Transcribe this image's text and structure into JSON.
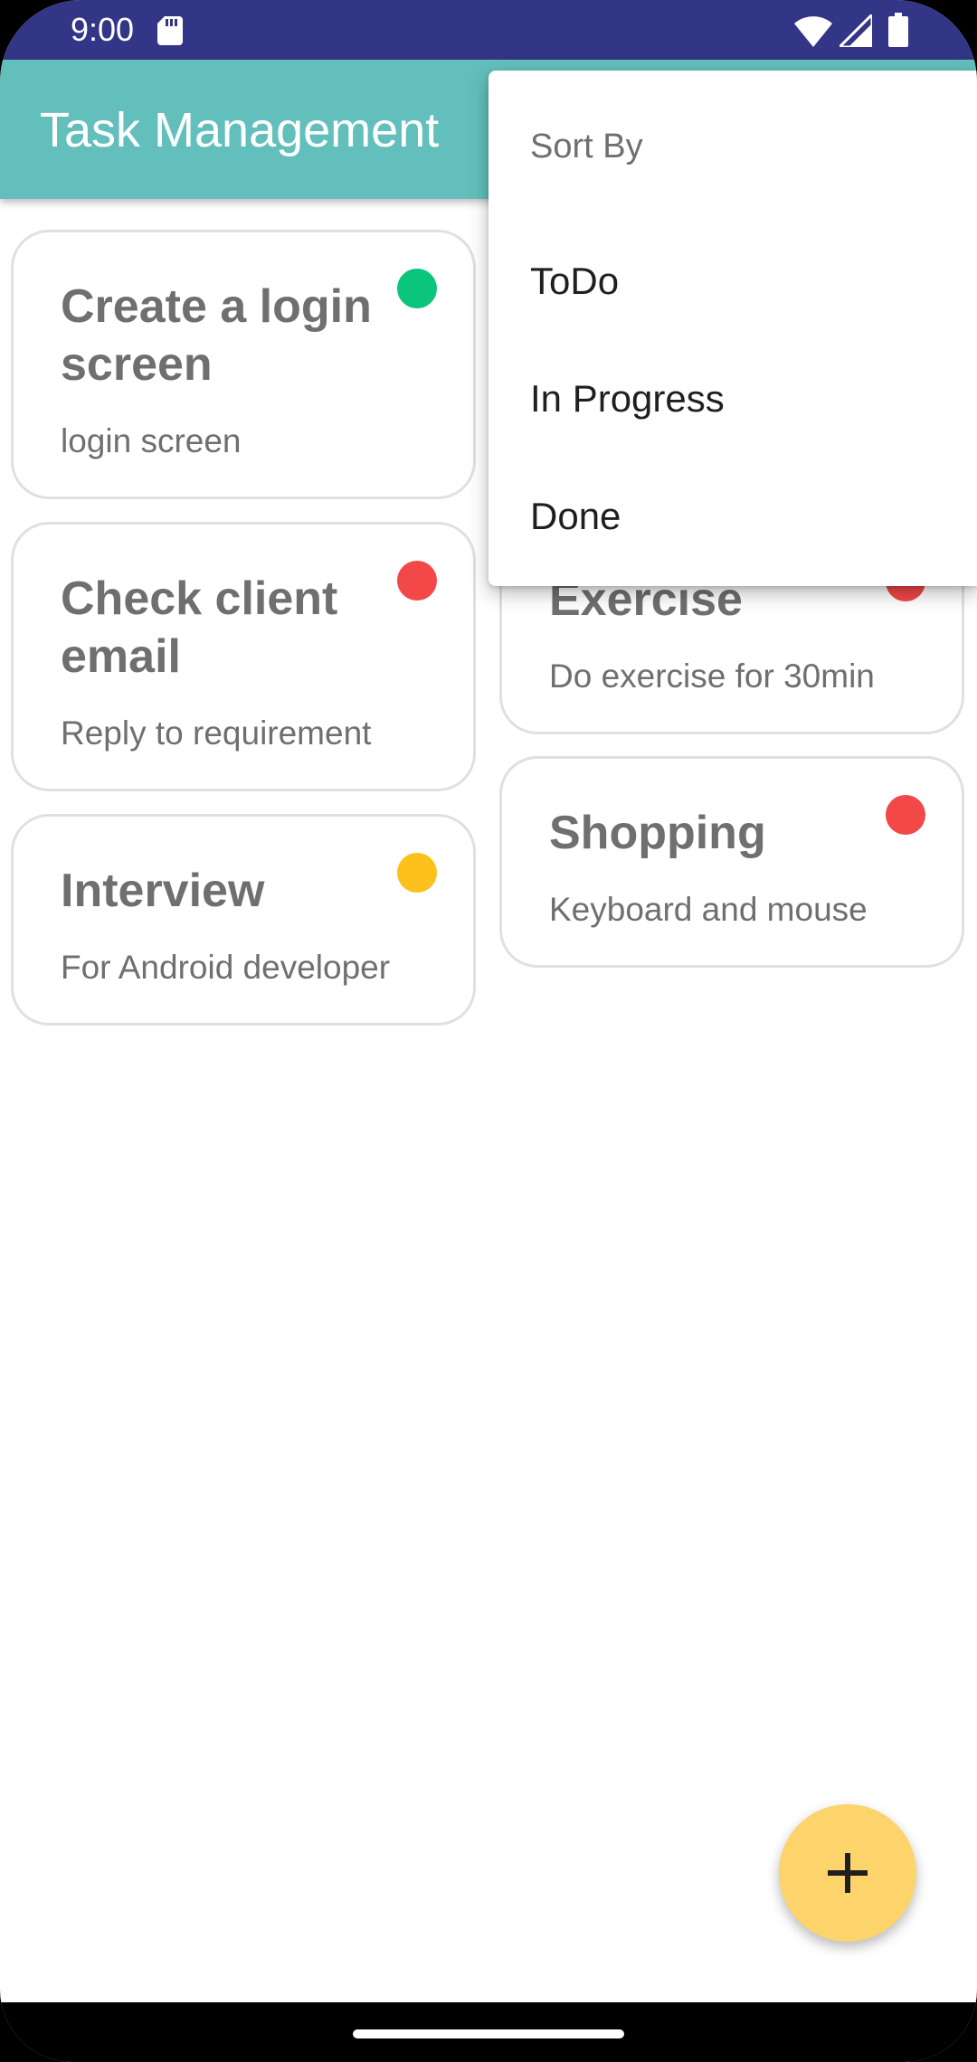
{
  "status_bar": {
    "time": "9:00",
    "icons": [
      "sd-card-icon",
      "wifi-icon",
      "signal-icon",
      "battery-icon"
    ]
  },
  "app_bar": {
    "title": "Task Management"
  },
  "tasks_left": [
    {
      "title": "Create a login screen",
      "description": "login screen",
      "status_color": "#0bc57b"
    },
    {
      "title": "Check client email",
      "description": "Reply to requirement",
      "status_color": "#f34848"
    },
    {
      "title": "Interview",
      "description": "For Android developer",
      "status_color": "#fdc11d"
    }
  ],
  "tasks_right": [
    {
      "title": "Exercise",
      "description": "Do exercise for 30min",
      "status_color": "#f34848"
    },
    {
      "title": "Shopping",
      "description": "Keyboard and mouse",
      "status_color": "#f34848"
    }
  ],
  "sort_menu": {
    "header": "Sort By",
    "items": [
      "ToDo",
      "In Progress",
      "Done"
    ]
  },
  "fab": {
    "icon": "plus-icon"
  },
  "colors": {
    "status_bar": "#333586",
    "app_bar": "#63bfbc",
    "fab": "#fdd36b",
    "green": "#0bc57b",
    "red": "#f34848",
    "yellow": "#fdc11d"
  }
}
